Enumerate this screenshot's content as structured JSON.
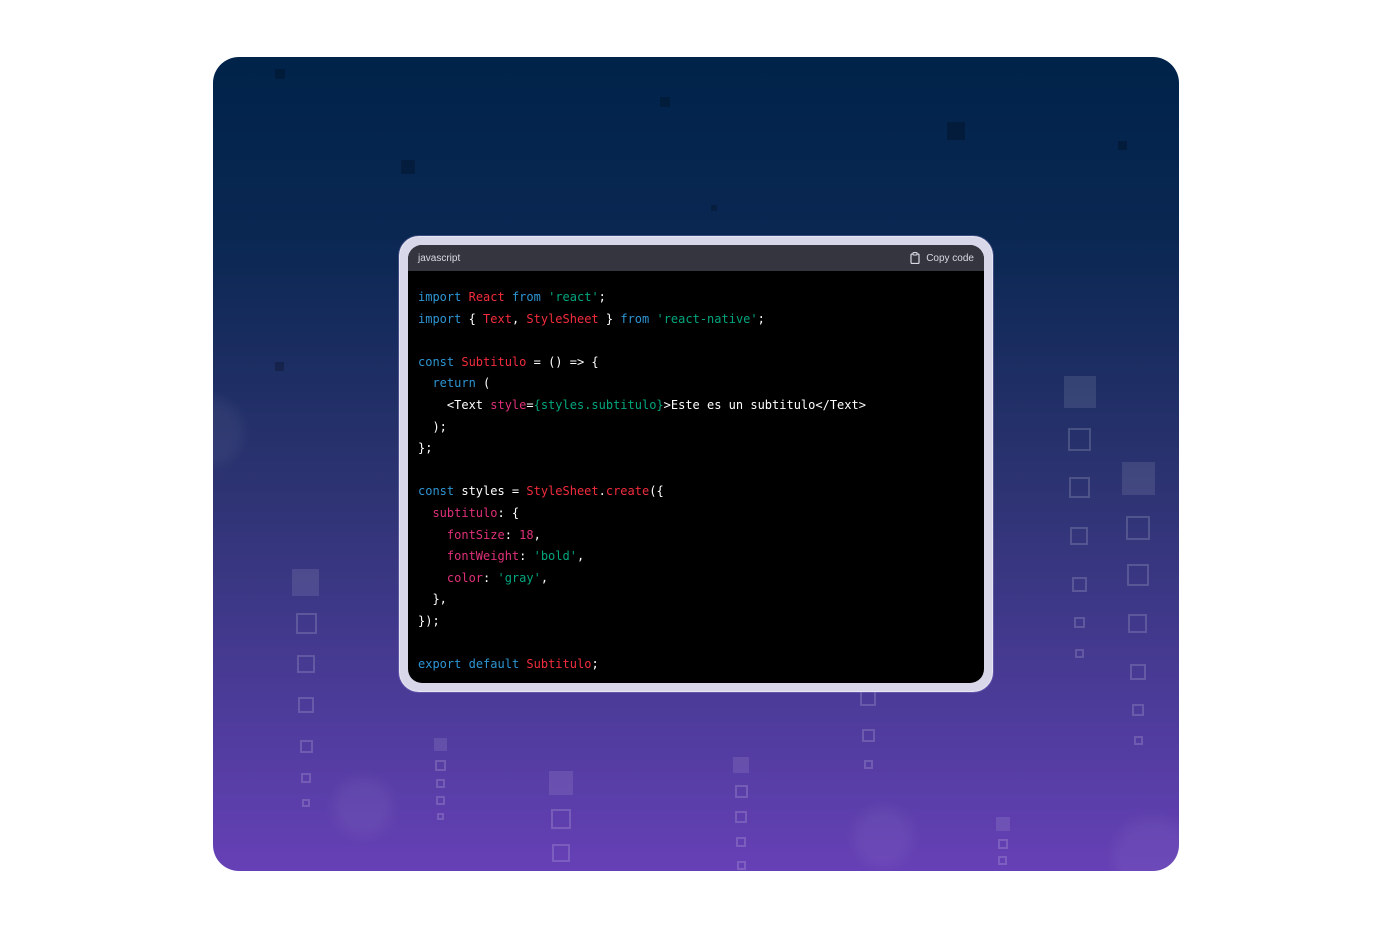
{
  "code_block": {
    "language": "javascript",
    "copy_label": "Copy code",
    "copy_icon": "clipboard-icon",
    "lines": [
      [
        {
          "t": "import",
          "c": "kw"
        },
        {
          "t": " ",
          "c": "tx"
        },
        {
          "t": "React",
          "c": "id"
        },
        {
          "t": " ",
          "c": "tx"
        },
        {
          "t": "from",
          "c": "kw"
        },
        {
          "t": " ",
          "c": "tx"
        },
        {
          "t": "'react'",
          "c": "str"
        },
        {
          "t": ";",
          "c": "tx"
        }
      ],
      [
        {
          "t": "import",
          "c": "kw"
        },
        {
          "t": " { ",
          "c": "tx"
        },
        {
          "t": "Text",
          "c": "id"
        },
        {
          "t": ", ",
          "c": "tx"
        },
        {
          "t": "StyleSheet",
          "c": "id"
        },
        {
          "t": " } ",
          "c": "tx"
        },
        {
          "t": "from",
          "c": "kw"
        },
        {
          "t": " ",
          "c": "tx"
        },
        {
          "t": "'react-native'",
          "c": "str"
        },
        {
          "t": ";",
          "c": "tx"
        }
      ],
      [],
      [
        {
          "t": "const",
          "c": "kw"
        },
        {
          "t": " ",
          "c": "tx"
        },
        {
          "t": "Subtitulo",
          "c": "id"
        },
        {
          "t": " = () => {",
          "c": "tx"
        }
      ],
      [
        {
          "t": "  ",
          "c": "tx"
        },
        {
          "t": "return",
          "c": "kw"
        },
        {
          "t": " (",
          "c": "tx"
        }
      ],
      [
        {
          "t": "    <Text ",
          "c": "tx"
        },
        {
          "t": "style",
          "c": "pr"
        },
        {
          "t": "=",
          "c": "tx"
        },
        {
          "t": "{styles.subtitulo}",
          "c": "str"
        },
        {
          "t": ">Este es un subtitulo</Text>",
          "c": "tx"
        }
      ],
      [
        {
          "t": "  );",
          "c": "tx"
        }
      ],
      [
        {
          "t": "};",
          "c": "tx"
        }
      ],
      [],
      [
        {
          "t": "const",
          "c": "kw"
        },
        {
          "t": " styles = ",
          "c": "tx"
        },
        {
          "t": "StyleSheet",
          "c": "id"
        },
        {
          "t": ".",
          "c": "tx"
        },
        {
          "t": "create",
          "c": "id"
        },
        {
          "t": "({",
          "c": "tx"
        }
      ],
      [
        {
          "t": "  ",
          "c": "tx"
        },
        {
          "t": "subtitulo",
          "c": "pr"
        },
        {
          "t": ": {",
          "c": "tx"
        }
      ],
      [
        {
          "t": "    ",
          "c": "tx"
        },
        {
          "t": "fontSize",
          "c": "pr"
        },
        {
          "t": ": ",
          "c": "tx"
        },
        {
          "t": "18",
          "c": "nm"
        },
        {
          "t": ",",
          "c": "tx"
        }
      ],
      [
        {
          "t": "    ",
          "c": "tx"
        },
        {
          "t": "fontWeight",
          "c": "pr"
        },
        {
          "t": ": ",
          "c": "tx"
        },
        {
          "t": "'bold'",
          "c": "str"
        },
        {
          "t": ",",
          "c": "tx"
        }
      ],
      [
        {
          "t": "    ",
          "c": "tx"
        },
        {
          "t": "color",
          "c": "pr"
        },
        {
          "t": ": ",
          "c": "tx"
        },
        {
          "t": "'gray'",
          "c": "str"
        },
        {
          "t": ",",
          "c": "tx"
        }
      ],
      [
        {
          "t": "  },",
          "c": "tx"
        }
      ],
      [
        {
          "t": "});",
          "c": "tx"
        }
      ],
      [],
      [
        {
          "t": "export",
          "c": "kw"
        },
        {
          "t": " ",
          "c": "tx"
        },
        {
          "t": "default",
          "c": "kw"
        },
        {
          "t": " ",
          "c": "tx"
        },
        {
          "t": "Subtitulo",
          "c": "id"
        },
        {
          "t": ";",
          "c": "tx"
        }
      ]
    ]
  },
  "colors": {
    "keyword": "#2e95d3",
    "identifier": "#f22c3d",
    "string": "#00a67d",
    "property": "#df3079",
    "background_top": "#00234a",
    "background_bottom": "#6640b6",
    "code_background": "#000000",
    "header_bar": "#353540"
  }
}
